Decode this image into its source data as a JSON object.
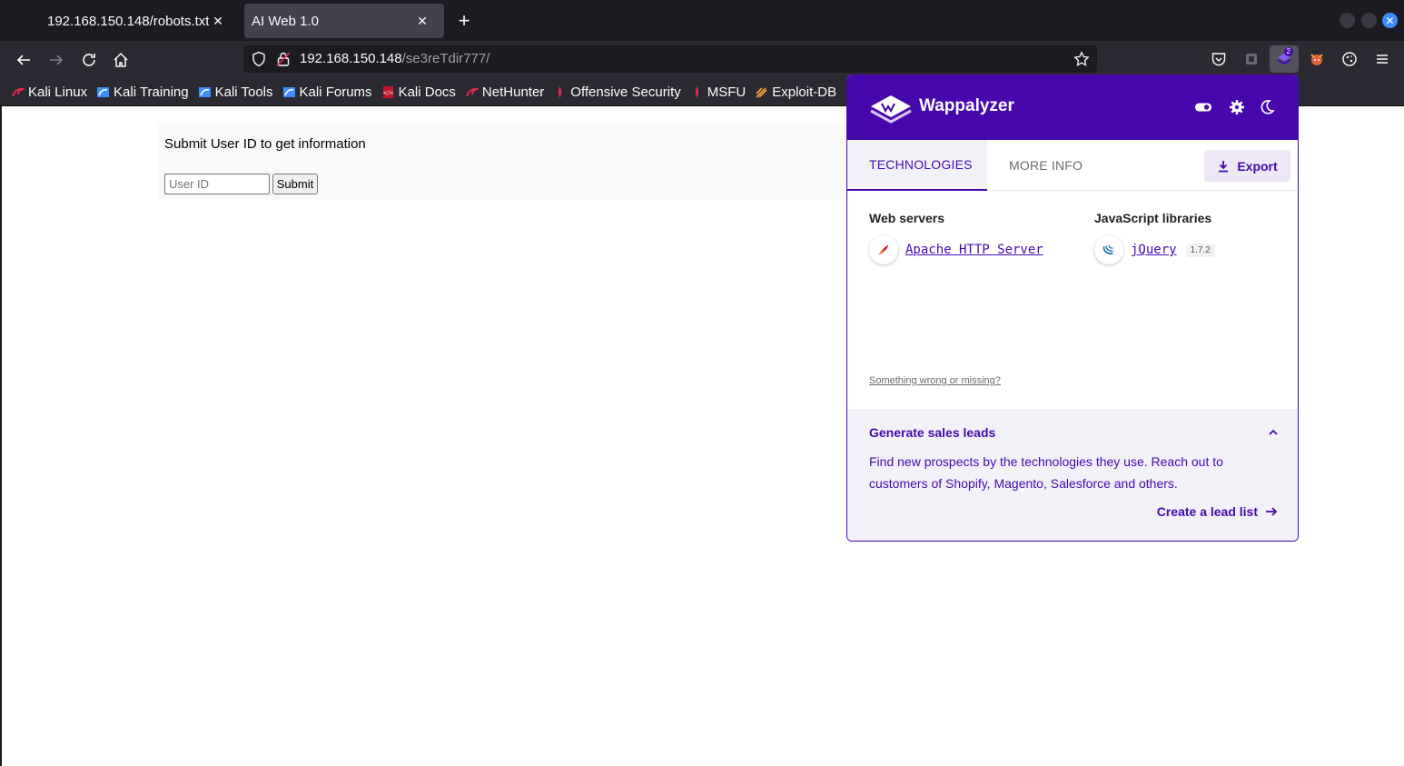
{
  "tabs": [
    {
      "title": "192.168.150.148/robots.txt",
      "active": false
    },
    {
      "title": "AI Web 1.0",
      "active": true
    }
  ],
  "url": {
    "host": "192.168.150.148",
    "path": "/se3reTdir777/"
  },
  "wappalyzer_badge": "2",
  "bookmarks": [
    "Kali Linux",
    "Kali Training",
    "Kali Tools",
    "Kali Forums",
    "Kali Docs",
    "NetHunter",
    "Offensive Security",
    "MSFU",
    "Exploit-DB"
  ],
  "page": {
    "form_title": "Submit User ID to get information",
    "input_placeholder": "User ID",
    "submit_label": "Submit"
  },
  "wappalyzer": {
    "name": "Wappalyzer",
    "tabs": {
      "technologies": "TECHNOLOGIES",
      "more_info": "MORE INFO"
    },
    "export_label": "Export",
    "categories": [
      {
        "name": "Web servers",
        "tech": "Apache HTTP Server",
        "version": ""
      },
      {
        "name": "JavaScript libraries",
        "tech": "jQuery",
        "version": "1.7.2"
      }
    ],
    "wrong_link": "Something wrong or missing?",
    "leads": {
      "title": "Generate sales leads",
      "text": "Find new prospects by the technologies they use. Reach out to customers of Shopify, Magento, Salesforce and others.",
      "cta": "Create a lead list"
    }
  },
  "colors": {
    "brand": "#4608ad",
    "chrome": "#2b2a33",
    "tabstrip": "#1c1b22"
  }
}
